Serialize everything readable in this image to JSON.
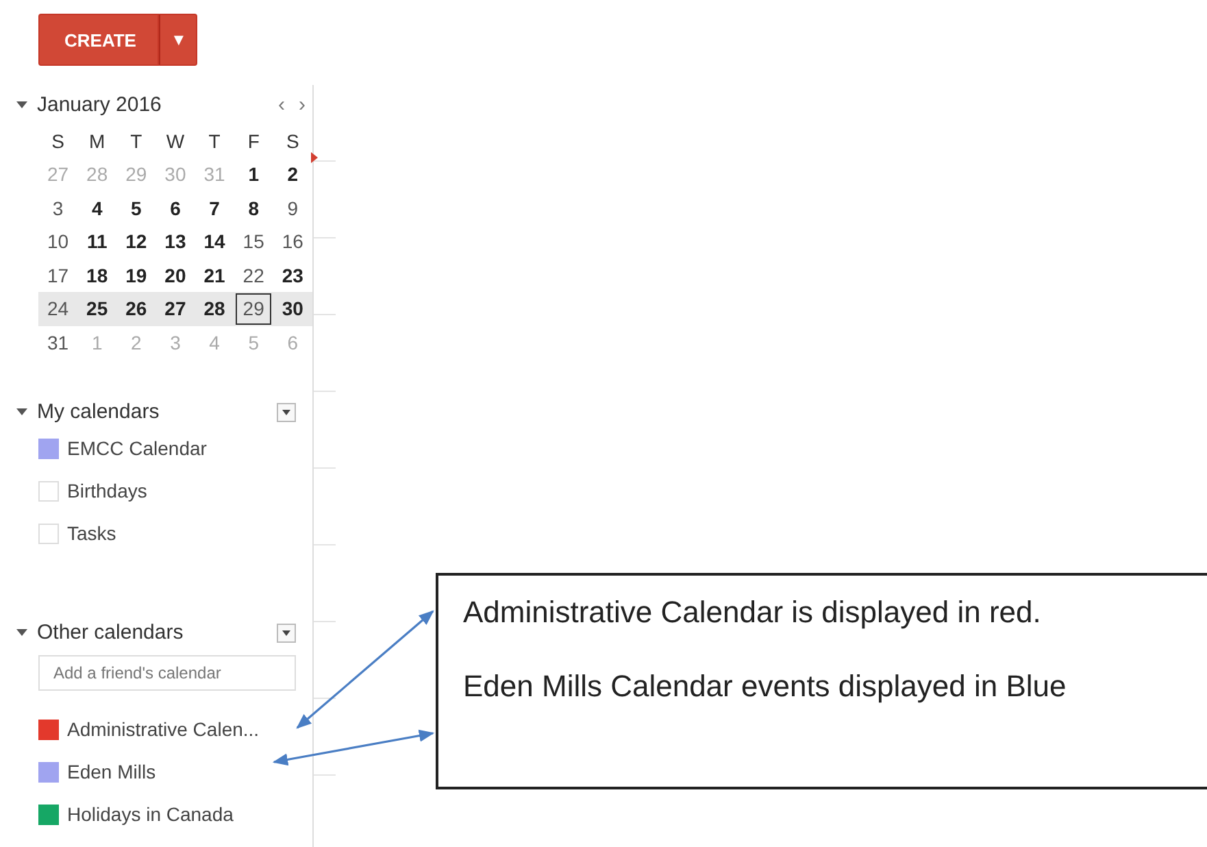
{
  "create_button": {
    "label": "CREATE",
    "menu_glyph": "▼"
  },
  "mini_calendar": {
    "title": "January 2016",
    "prev": "‹",
    "next": "›",
    "expanded": true,
    "weekdays": [
      "S",
      "M",
      "T",
      "W",
      "T",
      "F",
      "S"
    ],
    "weeks": [
      {
        "selected": false,
        "days": [
          {
            "label": "27",
            "kind": "other",
            "today": false
          },
          {
            "label": "28",
            "kind": "other",
            "today": false
          },
          {
            "label": "29",
            "kind": "other",
            "today": false
          },
          {
            "label": "30",
            "kind": "other",
            "today": false
          },
          {
            "label": "31",
            "kind": "other",
            "today": false
          },
          {
            "label": "1",
            "kind": "busy",
            "today": false
          },
          {
            "label": "2",
            "kind": "busy",
            "today": false
          }
        ]
      },
      {
        "selected": false,
        "days": [
          {
            "label": "3",
            "kind": "plain",
            "today": false
          },
          {
            "label": "4",
            "kind": "busy",
            "today": false
          },
          {
            "label": "5",
            "kind": "busy",
            "today": false
          },
          {
            "label": "6",
            "kind": "busy",
            "today": false
          },
          {
            "label": "7",
            "kind": "busy",
            "today": false
          },
          {
            "label": "8",
            "kind": "busy",
            "today": false
          },
          {
            "label": "9",
            "kind": "plain",
            "today": false
          }
        ]
      },
      {
        "selected": false,
        "days": [
          {
            "label": "10",
            "kind": "plain",
            "today": false
          },
          {
            "label": "11",
            "kind": "busy",
            "today": false
          },
          {
            "label": "12",
            "kind": "busy",
            "today": false
          },
          {
            "label": "13",
            "kind": "busy",
            "today": false
          },
          {
            "label": "14",
            "kind": "busy",
            "today": false
          },
          {
            "label": "15",
            "kind": "plain",
            "today": false
          },
          {
            "label": "16",
            "kind": "plain",
            "today": false
          }
        ]
      },
      {
        "selected": false,
        "days": [
          {
            "label": "17",
            "kind": "plain",
            "today": false
          },
          {
            "label": "18",
            "kind": "busy",
            "today": false
          },
          {
            "label": "19",
            "kind": "busy",
            "today": false
          },
          {
            "label": "20",
            "kind": "busy",
            "today": false
          },
          {
            "label": "21",
            "kind": "busy",
            "today": false
          },
          {
            "label": "22",
            "kind": "plain",
            "today": false
          },
          {
            "label": "23",
            "kind": "busy",
            "today": false
          }
        ]
      },
      {
        "selected": true,
        "days": [
          {
            "label": "24",
            "kind": "plain",
            "today": false
          },
          {
            "label": "25",
            "kind": "busy",
            "today": false
          },
          {
            "label": "26",
            "kind": "busy",
            "today": false
          },
          {
            "label": "27",
            "kind": "busy",
            "today": false
          },
          {
            "label": "28",
            "kind": "busy",
            "today": false
          },
          {
            "label": "29",
            "kind": "plain",
            "today": true
          },
          {
            "label": "30",
            "kind": "busy",
            "today": false
          }
        ]
      },
      {
        "selected": false,
        "days": [
          {
            "label": "31",
            "kind": "plain",
            "today": false
          },
          {
            "label": "1",
            "kind": "other",
            "today": false
          },
          {
            "label": "2",
            "kind": "other",
            "today": false
          },
          {
            "label": "3",
            "kind": "other",
            "today": false
          },
          {
            "label": "4",
            "kind": "other",
            "today": false
          },
          {
            "label": "5",
            "kind": "other",
            "today": false
          },
          {
            "label": "6",
            "kind": "other",
            "today": false
          }
        ]
      }
    ]
  },
  "my_calendars": {
    "title": "My calendars",
    "expanded": true,
    "items": [
      {
        "name": "EMCC Calendar",
        "checked": true,
        "color": "#a0a4f0"
      },
      {
        "name": "Birthdays",
        "checked": false
      },
      {
        "name": "Tasks",
        "checked": false
      }
    ]
  },
  "other_calendars": {
    "title": "Other calendars",
    "expanded": true,
    "add_field": {
      "placeholder": "Add a friend's calendar"
    },
    "items": [
      {
        "name": "Administrative Calen...",
        "checked": true,
        "color": "#e3392c"
      },
      {
        "name": "Eden Mills",
        "checked": true,
        "color": "#a0a4f0"
      },
      {
        "name": "Holidays in Canada",
        "checked": true,
        "color": "#16a765"
      }
    ]
  },
  "callout": {
    "lines": [
      "Administrative Calendar is displayed in red.",
      "Eden Mills Calendar events displayed in Blue"
    ]
  }
}
